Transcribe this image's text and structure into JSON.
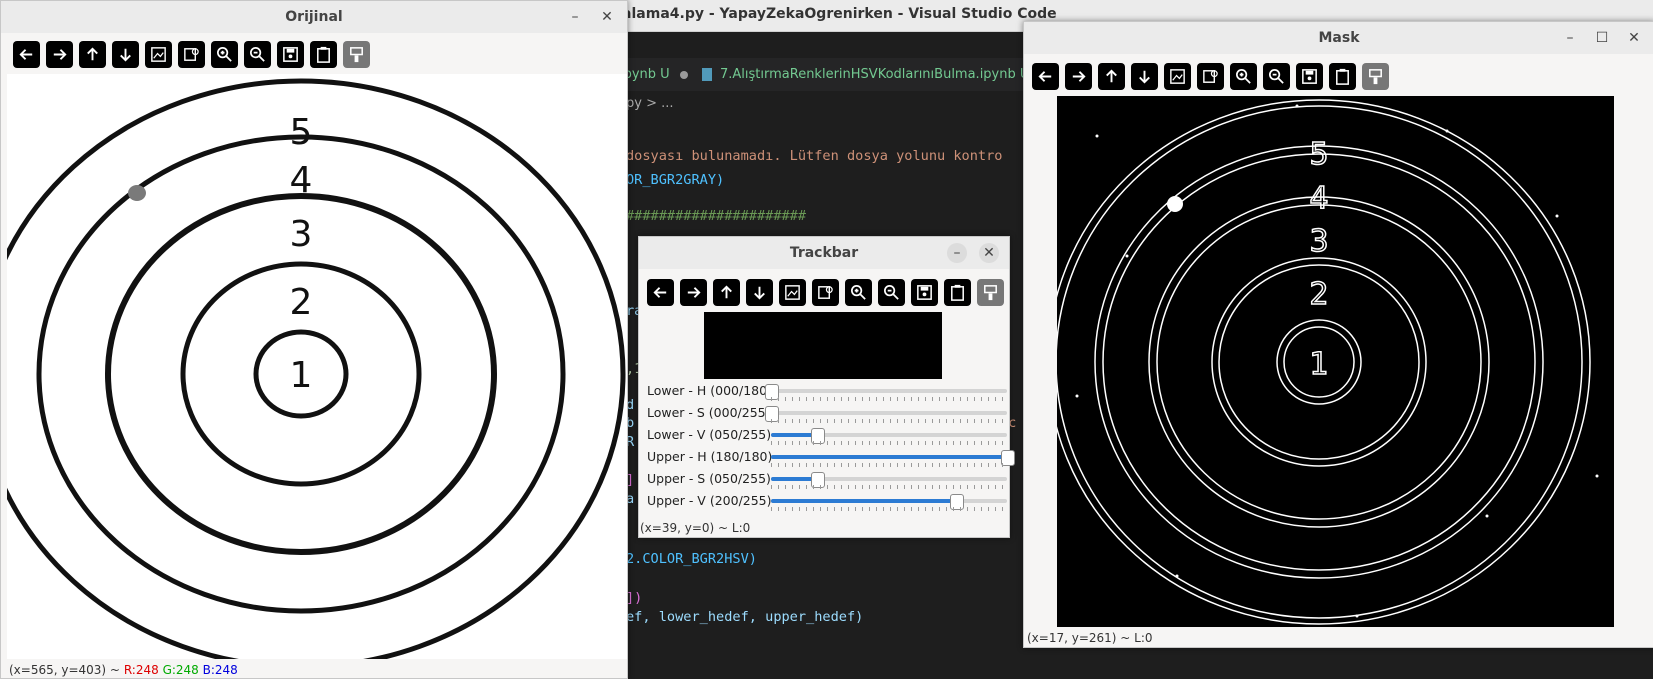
{
  "vscode": {
    "title": "karalama4.py - YapayZekaOgrenirken - Visual Studio Code",
    "tab1_label": "ipynb U",
    "tab2_label": "7.AlıştırmaRenklerinHSVKodlarınıBulma.ipynb U",
    "breadcrumb": "py > ...",
    "code": [
      {
        "text": "dosyası bulunamadı. Lütfen dosya yolunu kontro",
        "color": "#ce9178"
      },
      {
        "text": "OR_BGR2GRAY)",
        "color": "#4fc1ff"
      },
      {
        "text": "######################",
        "color": "#6a9955"
      },
      {
        "text": "ra",
        "color": "#9cdcfe"
      },
      {
        "text": ",1",
        "color": "#b5cea8"
      },
      {
        "text": "d",
        "color": "#9cdcfe"
      },
      {
        "text": "b",
        "color": "#9cdcfe"
      },
      {
        "text": "ec",
        "color": "#ce9178"
      },
      {
        "text": "R",
        "color": "#9cdcfe"
      },
      {
        "text": "]",
        "color": "#da70d6"
      },
      {
        "text": "a",
        "color": "#9cdcfe"
      },
      {
        "text": "2.COLOR_BGR2HSV)",
        "color": "#4fc1ff"
      },
      {
        "text": "])",
        "color": "#da70d6"
      },
      {
        "text": "ef, lower_hedef, upper_hedef)",
        "color": "#9cdcfe"
      }
    ]
  },
  "orijinal": {
    "title": "Orijinal",
    "status_prefix": "(x=565, y=403) ~",
    "status_r": "R:248",
    "status_g": "G:248",
    "status_b": "B:248"
  },
  "trackbar": {
    "title": "Trackbar",
    "sliders": [
      {
        "label": "Lower - H  (000/180)",
        "value": 0,
        "max": 180
      },
      {
        "label": "Lower - S  (000/255)",
        "value": 0,
        "max": 255
      },
      {
        "label": "Lower - V  (050/255)",
        "value": 50,
        "max": 255
      },
      {
        "label": "Upper - H  (180/180)",
        "value": 180,
        "max": 180
      },
      {
        "label": "Upper - S  (050/255)",
        "value": 50,
        "max": 255
      },
      {
        "label": "Upper - V  (200/255)",
        "value": 200,
        "max": 255
      }
    ],
    "status": "(x=39, y=0) ~ L:0"
  },
  "mask": {
    "title": "Mask",
    "status": "(x=17, y=261) ~ L:0"
  },
  "target_numbers": [
    "1",
    "2",
    "3",
    "4",
    "5"
  ],
  "toolbar_icons": [
    "pan-left-icon",
    "pan-right-icon",
    "pan-up-icon",
    "pan-down-icon",
    "zoom-fit-icon",
    "zoom-original-icon",
    "zoom-in-icon",
    "zoom-out-icon",
    "save-icon",
    "copy-clipboard-icon",
    "properties-icon"
  ]
}
